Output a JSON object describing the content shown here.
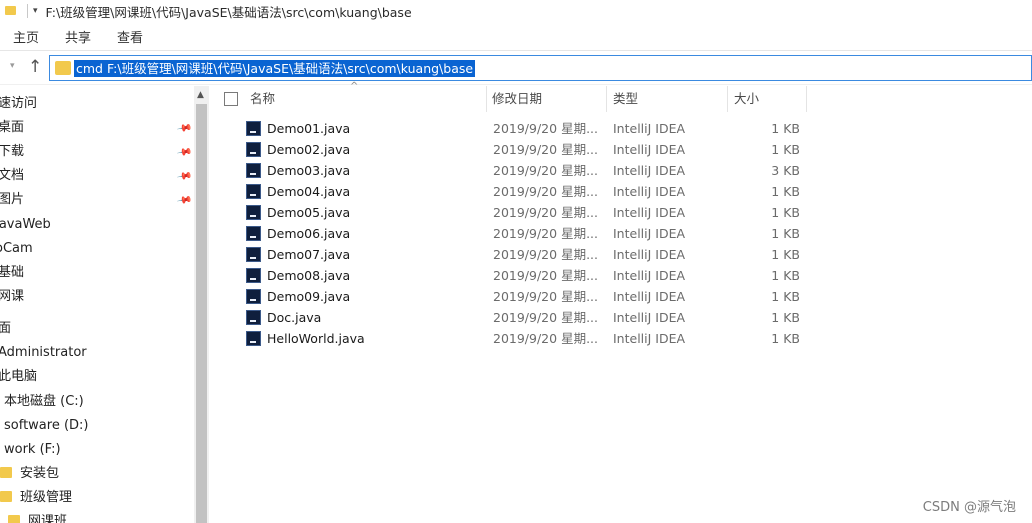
{
  "titlebar": {
    "path": "F:\\班级管理\\网课班\\代码\\JavaSE\\基础语法\\src\\com\\kuang\\base"
  },
  "ribbon": {
    "tabs": [
      "主页",
      "共享",
      "查看"
    ]
  },
  "address": {
    "value": "cmd F:\\班级管理\\网课班\\代码\\JavaSE\\基础语法\\src\\com\\kuang\\base"
  },
  "sidebar": {
    "items": [
      {
        "label": "速访问",
        "pinned": false
      },
      {
        "label": "桌面",
        "pinned": true
      },
      {
        "label": "下载",
        "pinned": true
      },
      {
        "label": "文档",
        "pinned": true
      },
      {
        "label": "图片",
        "pinned": true
      },
      {
        "label": "JavaWeb",
        "pinned": false
      },
      {
        "label": "oCam",
        "pinned": false
      },
      {
        "label": "基础",
        "pinned": false
      },
      {
        "label": "网课",
        "pinned": false
      },
      {
        "label": "面",
        "pinned": false
      },
      {
        "label": "Administrator",
        "pinned": false
      },
      {
        "label": "此电脑",
        "pinned": false
      },
      {
        "label": "本地磁盘 (C:)",
        "pinned": false
      },
      {
        "label": "software (D:)",
        "pinned": false
      },
      {
        "label": "work (F:)",
        "pinned": false
      },
      {
        "label": "安装包",
        "pinned": false
      },
      {
        "label": "班级管理",
        "pinned": false
      },
      {
        "label": "网课班",
        "pinned": false
      }
    ]
  },
  "columns": {
    "name": "名称",
    "date": "修改日期",
    "type": "类型",
    "size": "大小"
  },
  "files": [
    {
      "name": "Demo01.java",
      "date": "2019/9/20 星期...",
      "type": "IntelliJ IDEA",
      "size": "1 KB"
    },
    {
      "name": "Demo02.java",
      "date": "2019/9/20 星期...",
      "type": "IntelliJ IDEA",
      "size": "1 KB"
    },
    {
      "name": "Demo03.java",
      "date": "2019/9/20 星期...",
      "type": "IntelliJ IDEA",
      "size": "3 KB"
    },
    {
      "name": "Demo04.java",
      "date": "2019/9/20 星期...",
      "type": "IntelliJ IDEA",
      "size": "1 KB"
    },
    {
      "name": "Demo05.java",
      "date": "2019/9/20 星期...",
      "type": "IntelliJ IDEA",
      "size": "1 KB"
    },
    {
      "name": "Demo06.java",
      "date": "2019/9/20 星期...",
      "type": "IntelliJ IDEA",
      "size": "1 KB"
    },
    {
      "name": "Demo07.java",
      "date": "2019/9/20 星期...",
      "type": "IntelliJ IDEA",
      "size": "1 KB"
    },
    {
      "name": "Demo08.java",
      "date": "2019/9/20 星期...",
      "type": "IntelliJ IDEA",
      "size": "1 KB"
    },
    {
      "name": "Demo09.java",
      "date": "2019/9/20 星期...",
      "type": "IntelliJ IDEA",
      "size": "1 KB"
    },
    {
      "name": "Doc.java",
      "date": "2019/9/20 星期...",
      "type": "IntelliJ IDEA",
      "size": "1 KB"
    },
    {
      "name": "HelloWorld.java",
      "date": "2019/9/20 星期...",
      "type": "IntelliJ IDEA",
      "size": "1 KB"
    }
  ],
  "watermark": "CSDN @源气泡",
  "colors": {
    "selection": "#0a64d2",
    "address_border": "#3b8ae0",
    "folder": "#f2c94c"
  }
}
